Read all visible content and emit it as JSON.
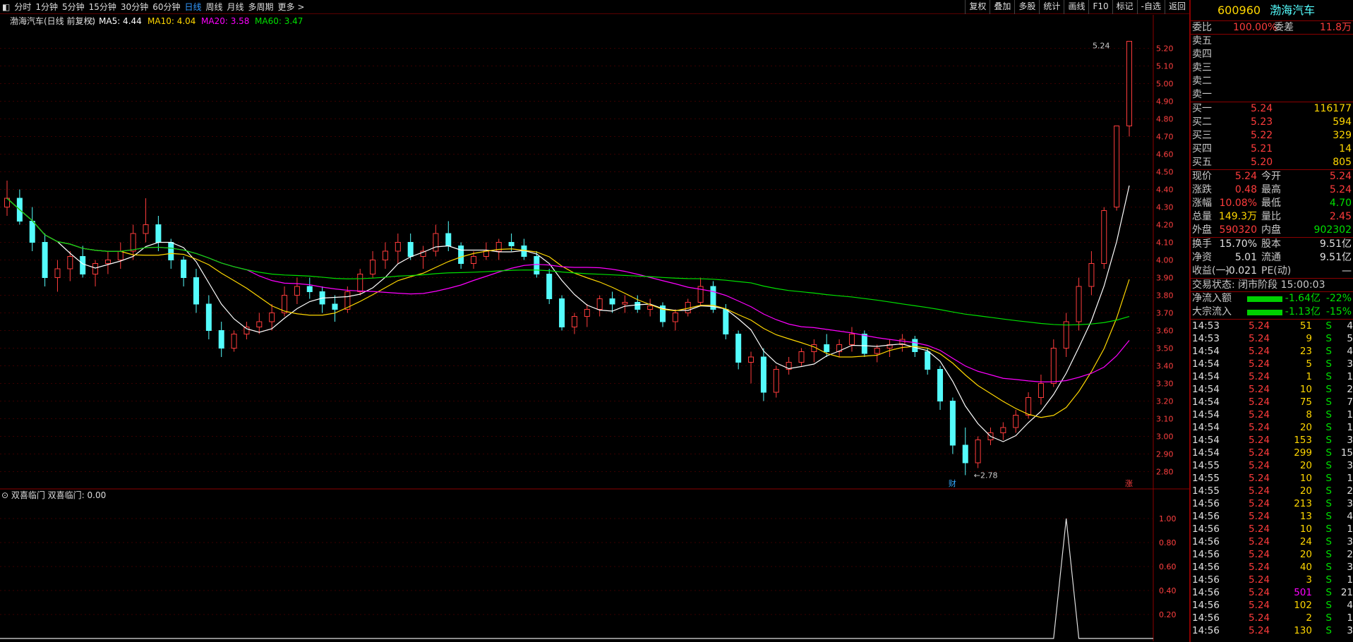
{
  "toolbar": {
    "corner": "◧",
    "periods": [
      "分时",
      "1分钟",
      "5分钟",
      "15分钟",
      "30分钟",
      "60分钟",
      "日线",
      "周线",
      "月线",
      "多周期",
      "更多 >"
    ],
    "active": "日线",
    "right": [
      "复权",
      "叠加",
      "多股",
      "统计",
      "画线",
      "F10",
      "标记",
      "-自选",
      "返回"
    ]
  },
  "chart": {
    "title": "渤海汽车(日线 前复权)",
    "ma_labels": [
      {
        "t": "MA5: 4.44",
        "c": "#ffffff"
      },
      {
        "t": "MA10: 4.04",
        "c": "#ffd700"
      },
      {
        "t": "MA20: 3.58",
        "c": "#ff00ff"
      },
      {
        "t": "MA60: 3.47",
        "c": "#00e000"
      }
    ],
    "yticks": [
      "5.20",
      "5.10",
      "5.00",
      "4.90",
      "4.80",
      "4.70",
      "4.60",
      "4.50",
      "4.40",
      "4.30",
      "4.20",
      "4.10",
      "4.00",
      "3.90",
      "3.80",
      "3.70",
      "3.60",
      "3.50",
      "3.40",
      "3.30",
      "3.20",
      "3.10",
      "3.00",
      "2.90",
      "2.80"
    ],
    "high_label": "5.24",
    "low_label": "←2.78",
    "marker_cai": "财",
    "marker_zhang": "涨",
    "indicator_title": "双喜临门 双喜临门: 0.00",
    "ind_yticks": [
      "1.00",
      "0.80",
      "0.60",
      "0.40",
      "0.20"
    ]
  },
  "panel": {
    "code": "600960",
    "name": "渤海汽车",
    "weibi_label": "委比",
    "weibi": "100.00%",
    "weicha_label": "委差",
    "weicha": "11.8万",
    "sells": [
      "卖五",
      "卖四",
      "卖三",
      "卖二",
      "卖一"
    ],
    "buys": [
      {
        "l": "买一",
        "p": "5.24",
        "v": "116177"
      },
      {
        "l": "买二",
        "p": "5.23",
        "v": "594"
      },
      {
        "l": "买三",
        "p": "5.22",
        "v": "329"
      },
      {
        "l": "买四",
        "p": "5.21",
        "v": "14"
      },
      {
        "l": "买五",
        "p": "5.20",
        "v": "805"
      }
    ],
    "quote": [
      [
        "现价",
        "5.24",
        "今开",
        "5.24"
      ],
      [
        "涨跌",
        "0.48",
        "最高",
        "5.24"
      ],
      [
        "涨幅",
        "10.08%",
        "最低",
        "4.70"
      ],
      [
        "总量",
        "149.3万",
        "量比",
        "2.45"
      ],
      [
        "外盘",
        "590320",
        "内盘",
        "902302"
      ]
    ],
    "quote2": [
      [
        "换手",
        "15.70%",
        "股本",
        "9.51亿"
      ],
      [
        "净资",
        "5.01",
        "流通",
        "9.51亿"
      ],
      [
        "收益(一)",
        "-0.021",
        "PE(动)",
        "—"
      ]
    ],
    "status": "交易状态: 闭市阶段 15:00:03",
    "flows": [
      {
        "l": "净流入额",
        "v": "-1.64亿",
        "p": "-22%"
      },
      {
        "l": "大宗流入",
        "v": "-1.13亿",
        "p": "-15%"
      }
    ],
    "ticks": [
      [
        "14:53",
        "5.24",
        "51",
        "S",
        "4"
      ],
      [
        "14:53",
        "5.24",
        "9",
        "S",
        "5"
      ],
      [
        "14:54",
        "5.24",
        "23",
        "S",
        "4"
      ],
      [
        "14:54",
        "5.24",
        "5",
        "S",
        "3"
      ],
      [
        "14:54",
        "5.24",
        "1",
        "S",
        "1"
      ],
      [
        "14:54",
        "5.24",
        "10",
        "S",
        "2"
      ],
      [
        "14:54",
        "5.24",
        "75",
        "S",
        "7"
      ],
      [
        "14:54",
        "5.24",
        "8",
        "S",
        "1"
      ],
      [
        "14:54",
        "5.24",
        "20",
        "S",
        "1"
      ],
      [
        "14:54",
        "5.24",
        "153",
        "S",
        "3"
      ],
      [
        "14:54",
        "5.24",
        "299",
        "S",
        "15"
      ],
      [
        "14:55",
        "5.24",
        "20",
        "S",
        "3"
      ],
      [
        "14:55",
        "5.24",
        "10",
        "S",
        "1"
      ],
      [
        "14:55",
        "5.24",
        "20",
        "S",
        "2"
      ],
      [
        "14:56",
        "5.24",
        "213",
        "S",
        "3"
      ],
      [
        "14:56",
        "5.24",
        "13",
        "S",
        "4"
      ],
      [
        "14:56",
        "5.24",
        "10",
        "S",
        "1"
      ],
      [
        "14:56",
        "5.24",
        "24",
        "S",
        "3"
      ],
      [
        "14:56",
        "5.24",
        "20",
        "S",
        "2"
      ],
      [
        "14:56",
        "5.24",
        "40",
        "S",
        "3"
      ],
      [
        "14:56",
        "5.24",
        "3",
        "S",
        "1"
      ],
      [
        "14:56",
        "5.24",
        "501",
        "S",
        "21"
      ],
      [
        "14:56",
        "5.24",
        "102",
        "S",
        "4"
      ],
      [
        "14:56",
        "5.24",
        "2",
        "S",
        "1"
      ],
      [
        "14:56",
        "5.24",
        "130",
        "S",
        "3"
      ]
    ]
  },
  "chart_data": {
    "type": "candlestick",
    "ylim": [
      2.75,
      5.27
    ],
    "candles": [
      [
        4.3,
        4.45,
        4.25,
        4.35
      ],
      [
        4.35,
        4.4,
        4.2,
        4.22
      ],
      [
        4.22,
        4.3,
        4.05,
        4.1
      ],
      [
        4.1,
        4.15,
        3.85,
        3.9
      ],
      [
        3.9,
        4.0,
        3.82,
        3.95
      ],
      [
        3.95,
        4.05,
        3.88,
        4.02
      ],
      [
        4.02,
        4.08,
        3.9,
        3.92
      ],
      [
        3.92,
        4.0,
        3.85,
        3.98
      ],
      [
        3.98,
        4.05,
        3.92,
        4.0
      ],
      [
        4.0,
        4.1,
        3.95,
        4.05
      ],
      [
        4.05,
        4.2,
        4.0,
        4.15
      ],
      [
        4.15,
        4.35,
        4.1,
        4.2
      ],
      [
        4.2,
        4.25,
        4.05,
        4.1
      ],
      [
        4.1,
        4.12,
        3.95,
        4.0
      ],
      [
        4.0,
        4.02,
        3.85,
        3.9
      ],
      [
        3.9,
        3.95,
        3.7,
        3.75
      ],
      [
        3.75,
        3.8,
        3.55,
        3.6
      ],
      [
        3.6,
        3.65,
        3.45,
        3.5
      ],
      [
        3.5,
        3.6,
        3.48,
        3.58
      ],
      [
        3.58,
        3.65,
        3.55,
        3.62
      ],
      [
        3.62,
        3.7,
        3.58,
        3.65
      ],
      [
        3.65,
        3.75,
        3.6,
        3.7
      ],
      [
        3.7,
        3.85,
        3.68,
        3.8
      ],
      [
        3.8,
        3.9,
        3.75,
        3.85
      ],
      [
        3.85,
        3.9,
        3.78,
        3.82
      ],
      [
        3.82,
        3.85,
        3.7,
        3.75
      ],
      [
        3.75,
        3.8,
        3.65,
        3.72
      ],
      [
        3.72,
        3.85,
        3.7,
        3.82
      ],
      [
        3.82,
        3.95,
        3.8,
        3.92
      ],
      [
        3.92,
        4.05,
        3.9,
        4.0
      ],
      [
        4.0,
        4.1,
        3.95,
        4.05
      ],
      [
        4.05,
        4.15,
        3.98,
        4.1
      ],
      [
        4.1,
        4.15,
        4.0,
        4.02
      ],
      [
        4.02,
        4.08,
        3.95,
        4.05
      ],
      [
        4.05,
        4.2,
        4.02,
        4.15
      ],
      [
        4.15,
        4.22,
        4.05,
        4.08
      ],
      [
        4.08,
        4.1,
        3.95,
        3.98
      ],
      [
        3.98,
        4.05,
        3.95,
        4.02
      ],
      [
        4.02,
        4.1,
        4.0,
        4.05
      ],
      [
        4.05,
        4.12,
        4.0,
        4.1
      ],
      [
        4.1,
        4.15,
        4.05,
        4.08
      ],
      [
        4.08,
        4.12,
        4.0,
        4.02
      ],
      [
        4.02,
        4.05,
        3.9,
        3.92
      ],
      [
        3.92,
        3.95,
        3.75,
        3.78
      ],
      [
        3.78,
        3.8,
        3.6,
        3.62
      ],
      [
        3.62,
        3.7,
        3.58,
        3.68
      ],
      [
        3.68,
        3.75,
        3.62,
        3.72
      ],
      [
        3.72,
        3.8,
        3.68,
        3.78
      ],
      [
        3.78,
        3.82,
        3.7,
        3.75
      ],
      [
        3.75,
        3.8,
        3.7,
        3.76
      ],
      [
        3.76,
        3.8,
        3.7,
        3.72
      ],
      [
        3.72,
        3.78,
        3.68,
        3.74
      ],
      [
        3.74,
        3.76,
        3.62,
        3.65
      ],
      [
        3.65,
        3.72,
        3.6,
        3.7
      ],
      [
        3.7,
        3.78,
        3.68,
        3.76
      ],
      [
        3.76,
        3.9,
        3.74,
        3.85
      ],
      [
        3.85,
        3.88,
        3.7,
        3.72
      ],
      [
        3.72,
        3.75,
        3.55,
        3.58
      ],
      [
        3.58,
        3.6,
        3.38,
        3.42
      ],
      [
        3.42,
        3.48,
        3.3,
        3.45
      ],
      [
        3.45,
        3.5,
        3.2,
        3.25
      ],
      [
        3.25,
        3.4,
        3.22,
        3.38
      ],
      [
        3.38,
        3.45,
        3.35,
        3.42
      ],
      [
        3.42,
        3.5,
        3.4,
        3.48
      ],
      [
        3.48,
        3.55,
        3.42,
        3.52
      ],
      [
        3.52,
        3.58,
        3.45,
        3.48
      ],
      [
        3.48,
        3.55,
        3.45,
        3.52
      ],
      [
        3.52,
        3.62,
        3.48,
        3.58
      ],
      [
        3.58,
        3.6,
        3.45,
        3.47
      ],
      [
        3.47,
        3.52,
        3.42,
        3.5
      ],
      [
        3.5,
        3.55,
        3.45,
        3.52
      ],
      [
        3.52,
        3.58,
        3.48,
        3.55
      ],
      [
        3.55,
        3.57,
        3.45,
        3.48
      ],
      [
        3.48,
        3.5,
        3.35,
        3.38
      ],
      [
        3.38,
        3.4,
        3.15,
        3.2
      ],
      [
        3.2,
        3.22,
        2.9,
        2.95
      ],
      [
        2.95,
        3.05,
        2.78,
        2.85
      ],
      [
        2.85,
        3.0,
        2.82,
        2.98
      ],
      [
        2.98,
        3.05,
        2.95,
        3.02
      ],
      [
        3.02,
        3.08,
        2.98,
        3.05
      ],
      [
        3.05,
        3.15,
        3.02,
        3.12
      ],
      [
        3.12,
        3.25,
        3.1,
        3.22
      ],
      [
        3.22,
        3.35,
        3.18,
        3.3
      ],
      [
        3.3,
        3.55,
        3.28,
        3.5
      ],
      [
        3.5,
        3.7,
        3.45,
        3.65
      ],
      [
        3.65,
        3.9,
        3.6,
        3.85
      ],
      [
        3.85,
        4.05,
        3.8,
        3.98
      ],
      [
        3.98,
        4.3,
        3.95,
        4.28
      ],
      [
        4.3,
        4.76,
        4.28,
        4.76
      ],
      [
        4.76,
        5.24,
        4.7,
        5.24
      ]
    ],
    "indicator_peak_index": 84
  }
}
